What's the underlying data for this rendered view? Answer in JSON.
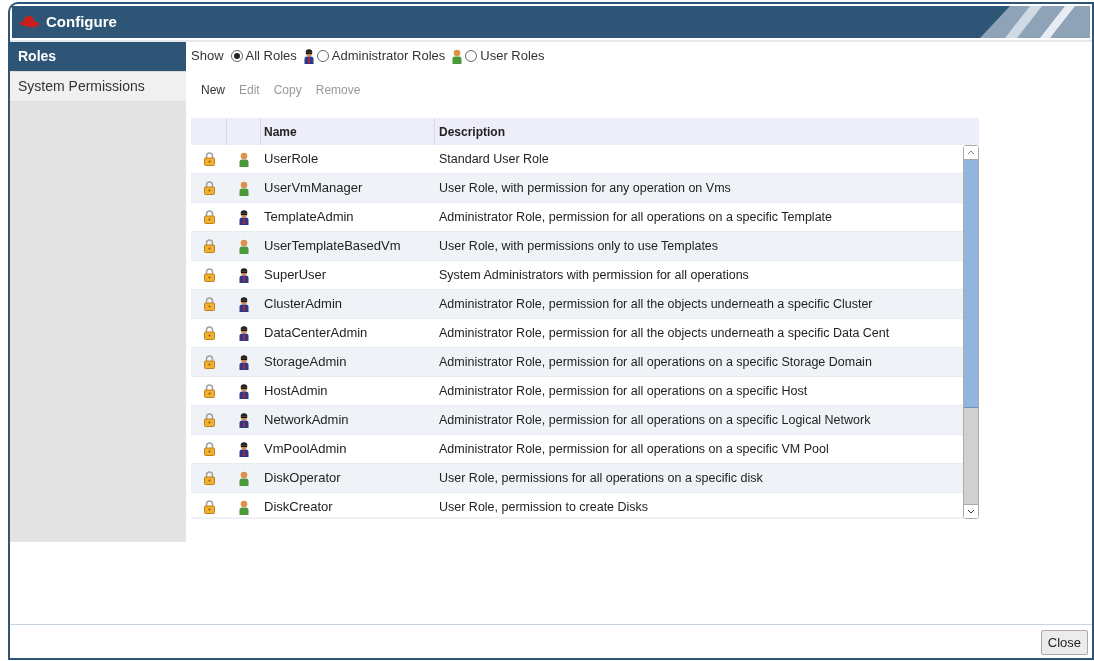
{
  "window": {
    "title": "Configure"
  },
  "sidebar": {
    "items": [
      {
        "label": "Roles",
        "selected": true
      },
      {
        "label": "System Permissions",
        "selected": false
      }
    ]
  },
  "filter": {
    "label": "Show",
    "options": [
      {
        "label": "All Roles",
        "selected": true,
        "kind": "all"
      },
      {
        "label": "Administrator Roles",
        "selected": false,
        "kind": "admin"
      },
      {
        "label": "User Roles",
        "selected": false,
        "kind": "user"
      }
    ]
  },
  "toolbar": [
    {
      "label": "New",
      "disabled": false
    },
    {
      "label": "Edit",
      "disabled": true
    },
    {
      "label": "Copy",
      "disabled": true
    },
    {
      "label": "Remove",
      "disabled": true
    }
  ],
  "table": {
    "columns": [
      "Name",
      "Description"
    ],
    "rows": [
      {
        "kind": "user",
        "name": "UserRole",
        "description": "Standard User Role"
      },
      {
        "kind": "user",
        "name": "UserVmManager",
        "description": "User Role, with permission for any operation on Vms"
      },
      {
        "kind": "admin",
        "name": "TemplateAdmin",
        "description": "Administrator Role, permission for all operations on a specific Template"
      },
      {
        "kind": "user",
        "name": "UserTemplateBasedVm",
        "description": "User Role, with permissions only to use Templates"
      },
      {
        "kind": "admin",
        "name": "SuperUser",
        "description": "System Administrators with permission for all operations"
      },
      {
        "kind": "admin",
        "name": "ClusterAdmin",
        "description": "Administrator Role, permission for all the objects underneath a specific Cluster"
      },
      {
        "kind": "admin",
        "name": "DataCenterAdmin",
        "description": "Administrator Role, permission for all the objects underneath a specific Data Cent"
      },
      {
        "kind": "admin",
        "name": "StorageAdmin",
        "description": "Administrator Role, permission for all operations on a specific Storage Domain"
      },
      {
        "kind": "admin",
        "name": "HostAdmin",
        "description": "Administrator Role, permission for all operations on a specific Host"
      },
      {
        "kind": "admin",
        "name": "NetworkAdmin",
        "description": "Administrator Role, permission for all operations on a specific Logical Network"
      },
      {
        "kind": "admin",
        "name": "VmPoolAdmin",
        "description": "Administrator Role, permission for all operations on a specific VM Pool"
      },
      {
        "kind": "user",
        "name": "DiskOperator",
        "description": "User Role, permissions for all operations on a specific disk"
      },
      {
        "kind": "user",
        "name": "DiskCreator",
        "description": "User Role, permission to create Disks"
      }
    ]
  },
  "buttons": [
    "Close"
  ]
}
